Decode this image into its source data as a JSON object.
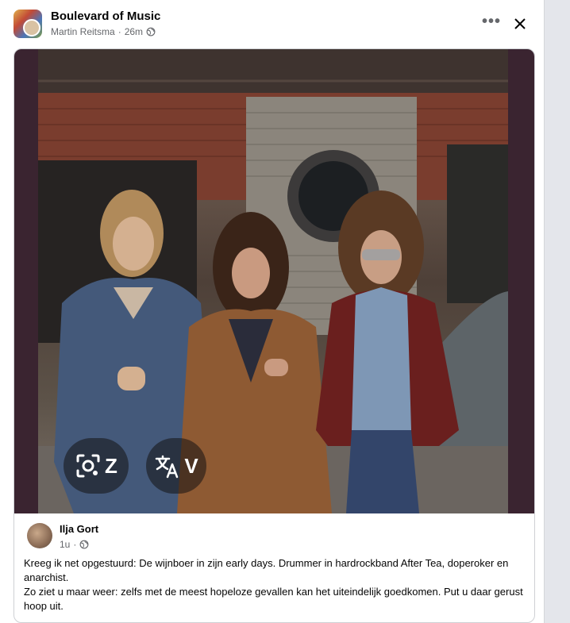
{
  "post": {
    "group_name": "Boulevard of Music",
    "author": "Martin Reitsma",
    "time": "26m",
    "separator": "·"
  },
  "photo": {
    "lens_label": "Z",
    "translate_label": "V"
  },
  "shared_post": {
    "author": "Ilja Gort",
    "time": "1u",
    "separator": "·",
    "text_line1": "Kreeg ik net opgestuurd: De wijnboer in zijn early days. Drummer in hardrockband After Tea, doperoker en anarchist.",
    "text_line2": "Zo ziet u maar weer: zelfs met de meest hopeloze gevallen kan het uiteindelijk goedkomen. Put u daar gerust hoop uit."
  },
  "icons": {
    "more": "more-options-icon",
    "close": "close-icon",
    "audience": "globe-icon",
    "lens": "lens-icon",
    "translate": "translate-icon"
  }
}
